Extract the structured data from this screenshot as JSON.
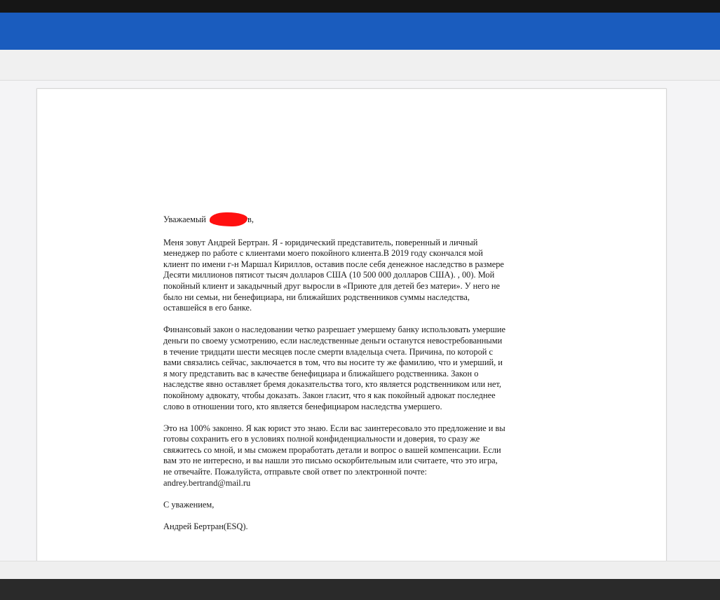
{
  "letter": {
    "greeting_prefix": "Уважаемый",
    "greeting_suffix": "в,",
    "p1": "Меня зовут Андрей Бертран. Я - юридический представитель, поверенный и личный менеджер по работе с клиентами моего покойного клиента.В 2019 году скончался мой клиент по имени г-н Маршал Кириллов, оставив после себя денежное наследство в размере Десяти миллионов пятисот тысяч долларов США (10 500 000 долларов США). , 00). Мой покойный клиент и закадычный друг выросли в «Приюте для детей без матери». У него не было ни семьи, ни бенефициара, ни ближайших родственников суммы наследства, оставшейся в его банке.",
    "p2": "Финансовый закон о наследовании четко разрешает умершему банку использовать умершие деньги по своему усмотрению, если наследственные деньги останутся невостребованными в течение тридцати шести месяцев после смерти владельца счета. Причина, по которой с вами связались сейчас, заключается в том, что вы носите ту же фамилию, что и умерший, и я могу представить вас в качестве бенефициара и ближайшего родственника. Закон о наследстве явно оставляет бремя доказательства того, кто является родственником или нет, покойному адвокату, чтобы доказать. Закон гласит, что я как покойный адвокат последнее слово в отношении того, кто является бенефициаром наследства умершего.",
    "p3": "Это на 100% законно. Я как юрист это знаю. Если вас заинтересовало это предложение и вы готовы сохранить его в условиях полной конфиденциальности и доверия, то сразу же свяжитесь со мной, и мы сможем проработать детали и вопрос о вашей компенсации. Если вам это не интересно, и вы нашли это письмо оскорбительным или считаете, что это игра, не отвечайте. Пожалуйста, отправьте свой ответ по электронной почте: andrey.bertrand@mail.ru",
    "closing": "С уважением,",
    "signature": "Андрей Бертран(ESQ)."
  },
  "colors": {
    "header_blue": "#1a5cbe",
    "redaction": "#ff1010"
  }
}
